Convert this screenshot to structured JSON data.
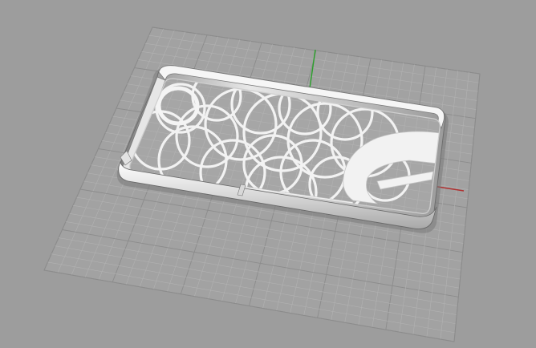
{
  "viewport": {
    "view": "perspective",
    "background_color": "#9d9d9d",
    "grid": {
      "visible": true,
      "fine_line_color": "#b2b2b2",
      "major_line_color": "#8c8c8c"
    },
    "axes": {
      "x_axis_color": "#b03030",
      "y_axis_color": "#2aa02a"
    }
  },
  "model": {
    "object": "phone-case",
    "pattern": "interlocking-circles",
    "logo": "letter-c-mark",
    "surface_color": "#f0f0f0",
    "shadow_color": "#8a8a8a"
  }
}
